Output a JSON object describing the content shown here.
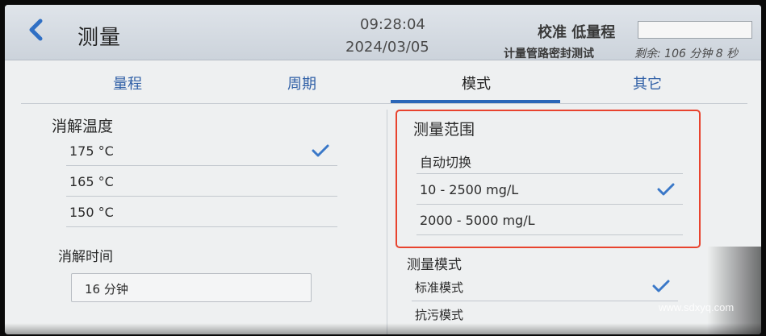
{
  "header": {
    "title": "测量",
    "time": "09:28:04",
    "date": "2024/03/05",
    "calibration_label": "校准 低量程",
    "task_label": "计量管路密封测试",
    "task_remaining": "剩余: 106 分钟 8 秒"
  },
  "tabs": [
    {
      "label": "量程",
      "active": false
    },
    {
      "label": "周期",
      "active": false
    },
    {
      "label": "模式",
      "active": true
    },
    {
      "label": "其它",
      "active": false
    }
  ],
  "left": {
    "digestion_temp": {
      "title": "消解温度",
      "options": [
        {
          "label": "175 °C",
          "selected": true
        },
        {
          "label": "165 °C",
          "selected": false
        },
        {
          "label": "150 °C",
          "selected": false
        }
      ]
    },
    "digestion_time": {
      "title": "消解时间",
      "value": "16 分钟"
    }
  },
  "right": {
    "measure_range": {
      "title": "测量范围",
      "options": [
        {
          "label": "自动切换",
          "selected": false
        },
        {
          "label": "10 - 2500 mg/L",
          "selected": true
        },
        {
          "label": "2000 - 5000 mg/L",
          "selected": false
        }
      ]
    },
    "measure_mode": {
      "title": "测量模式",
      "options": [
        {
          "label": "标准模式",
          "selected": true
        },
        {
          "label": "抗污模式",
          "selected": false
        }
      ]
    }
  },
  "watermark": "www.sdxyq.com",
  "colors": {
    "accent": "#2b66b8",
    "check": "#3a78c8",
    "highlight": "#e8432e"
  }
}
